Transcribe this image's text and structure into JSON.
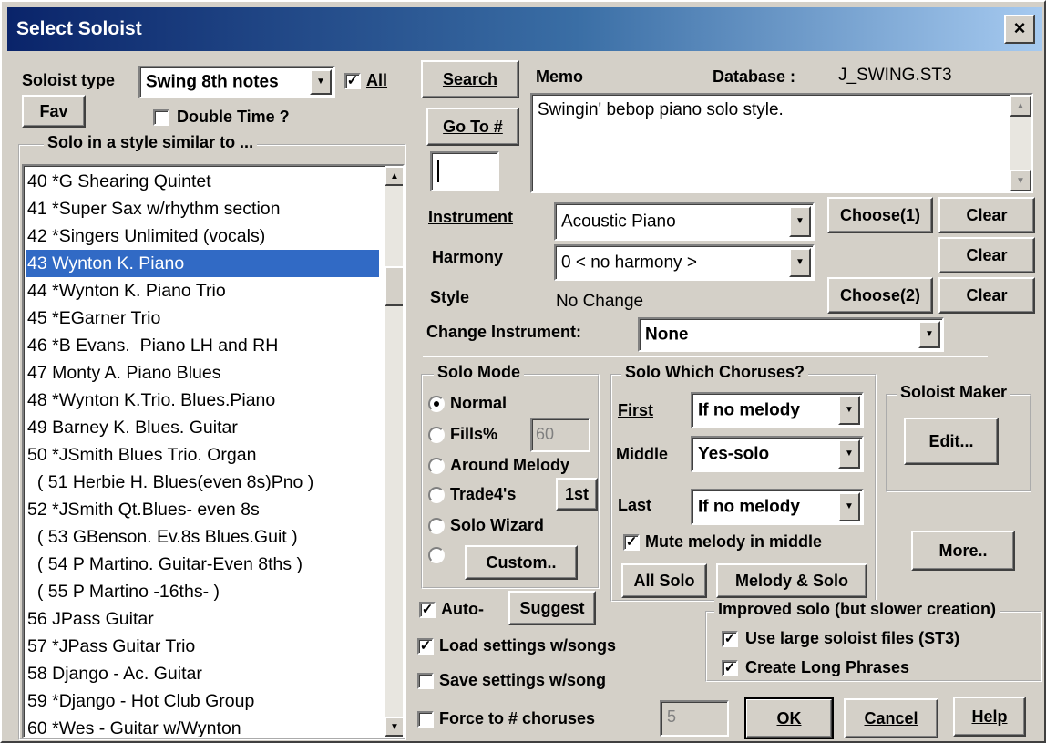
{
  "window": {
    "title": "Select Soloist",
    "close_glyph": "×"
  },
  "soloist_type": {
    "label": "Soloist type",
    "value": "Swing 8th notes",
    "all_label": "All",
    "all_checked": true
  },
  "fav_label": "Fav",
  "double_time": {
    "label": "Double Time ?",
    "checked": false
  },
  "solo_similar_label": "Solo in a style similar to ...",
  "soloist_list": [
    "40 *G Shearing Quintet",
    "41 *Super Sax w/rhythm section",
    "42 *Singers Unlimited (vocals)",
    "43 Wynton K. Piano",
    "44 *Wynton K. Piano Trio",
    "45 *EGarner Trio",
    "46 *B Evans.  Piano LH and RH",
    "47 Monty A. Piano Blues",
    "48 *Wynton K.Trio. Blues.Piano",
    "49 Barney K. Blues. Guitar",
    "50 *JSmith Blues Trio. Organ",
    "  ( 51 Herbie H. Blues(even 8s)Pno )",
    "52 *JSmith Qt.Blues- even 8s",
    "  ( 53 GBenson. Ev.8s Blues.Guit )",
    "  ( 54 P Martino. Guitar-Even 8ths )",
    "  ( 55 P Martino -16ths- )",
    "56 JPass Guitar",
    "57 *JPass Guitar Trio",
    "58 Django - Ac. Guitar",
    "59 *Django - Hot Club Group",
    "60 *Wes - Guitar w/Wynton"
  ],
  "selected_index": 3,
  "search_label": "Search",
  "goto_label": "Go To #",
  "goto_value": "",
  "memo": {
    "label": "Memo",
    "text": "Swingin' bebop piano solo style."
  },
  "database": {
    "label": "Database :",
    "value": "J_SWING.ST3"
  },
  "instrument": {
    "label": "Instrument",
    "value": "Acoustic Piano",
    "choose_label": "Choose(1)",
    "clear_label": "Clear"
  },
  "harmony": {
    "label": "Harmony",
    "value": "0 < no harmony >",
    "clear_label": "Clear"
  },
  "style": {
    "label": "Style",
    "value": "No Change",
    "choose_label": "Choose(2)",
    "clear_label": "Clear"
  },
  "change_instrument": {
    "label": "Change Instrument:",
    "value": "None"
  },
  "solo_mode": {
    "title": "Solo Mode",
    "normal": "Normal",
    "fills": "Fills%",
    "fills_value": "60",
    "around_melody": "Around Melody",
    "trade": "Trade4's",
    "first_label": "1st",
    "wizard": "Solo Wizard",
    "custom": "Custom.."
  },
  "choruses": {
    "title": "Solo Which Choruses?",
    "first_label": "First",
    "first_value": "If no melody",
    "middle_label": "Middle",
    "middle_value": "Yes-solo",
    "last_label": "Last",
    "last_value": "If no melody",
    "mute_label": "Mute melody in middle",
    "all_solo": "All Solo",
    "melody_solo": "Melody & Solo"
  },
  "soloist_maker": {
    "title": "Soloist Maker",
    "edit_label": "Edit..."
  },
  "more_label": "More..",
  "auto": {
    "label": "Auto-",
    "suggest": "Suggest"
  },
  "load_settings": "Load settings w/songs",
  "save_settings": "Save settings w/song",
  "force_choruses": {
    "label": "Force to # choruses",
    "value": "5"
  },
  "improved": {
    "title": "Improved solo (but slower creation)",
    "large_files": "Use large soloist files (ST3)",
    "long_phrases": "Create Long Phrases"
  },
  "ok_label": "OK",
  "cancel_label": "Cancel",
  "help_label": "Help"
}
